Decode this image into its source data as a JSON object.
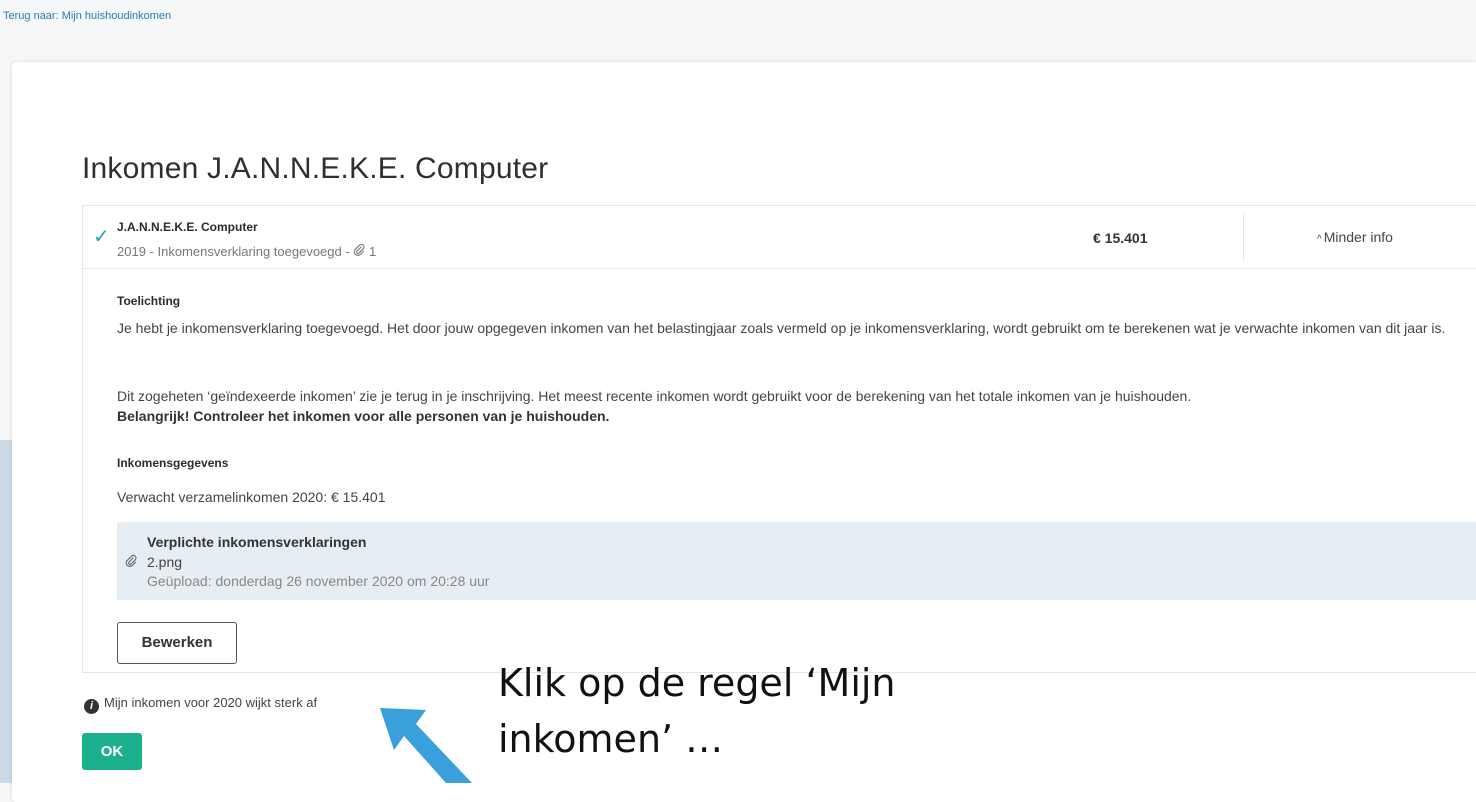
{
  "nav": {
    "back_link": "Terug naar: Mijn huishoudinkomen"
  },
  "page": {
    "title": "Inkomen J.A.N.N.E.K.E. Computer"
  },
  "income_item": {
    "name": "J.A.N.N.E.K.E. Computer",
    "subtitle": "2019 - Inkomensverklaring toegevoegd - ",
    "attachment_count": "1",
    "amount": "€  15.401",
    "toggle_label": "Minder info",
    "status_icon": "check-icon"
  },
  "details": {
    "explanation_title": "Toelichting",
    "paragraph1": "Je hebt je inkomensverklaring toegevoegd. Het door jouw opgegeven inkomen van het belastingjaar zoals vermeld op je inkomensverklaring, wordt gebruikt om te berekenen wat je verwachte inkomen van dit jaar is.",
    "paragraph2": "Dit zogeheten ‘geïndexeerde inkomen’ zie je terug in je inschrijving. Het meest recente inkomen wordt gebruikt voor de berekening van het totale inkomen van je huishouden.",
    "paragraph2_bold": "Belangrijk! Controleer het inkomen voor alle personen van je huishouden.",
    "income_data_title": "Inkomensgegevens",
    "expected_income": "Verwacht verzamelinkomen 2020: € 15.401"
  },
  "document": {
    "title": "Verplichte inkomensverklaringen",
    "file": "2.png",
    "uploaded": "Geüpload: donderdag 26 november 2020 om 20:28 uur"
  },
  "actions": {
    "edit_label": "Bewerken",
    "deviation_label": "Mijn inkomen voor 2020 wijkt sterk af",
    "ok_label": "OK"
  },
  "annotation": {
    "callout": "Klik op de regel ‘Mijn inkomen’ …",
    "arrow_color": "#3aa0dc"
  },
  "colors": {
    "accent_teal": "#22a6a0",
    "ok_green": "#1db08f",
    "link_blue": "#2a7ab0",
    "doc_box_bg": "#e6eef3"
  }
}
